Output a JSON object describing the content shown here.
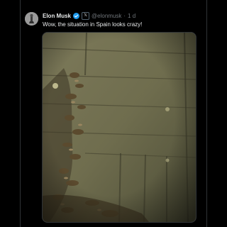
{
  "tweet": {
    "author_name": "Elon Musk",
    "verified": true,
    "affiliate_badge": "𝕏",
    "handle": "@elonmusk",
    "separator": "·",
    "time": "1 d",
    "text": "Wow, the situation in Spain looks crazy!"
  },
  "icons": {
    "verified": "verified-badge-icon",
    "affiliate": "x-logo-icon"
  },
  "colors": {
    "background": "#000000",
    "text": "#e7e9ea",
    "secondary_text": "#71767b",
    "verified_blue": "#1d9bf0"
  }
}
